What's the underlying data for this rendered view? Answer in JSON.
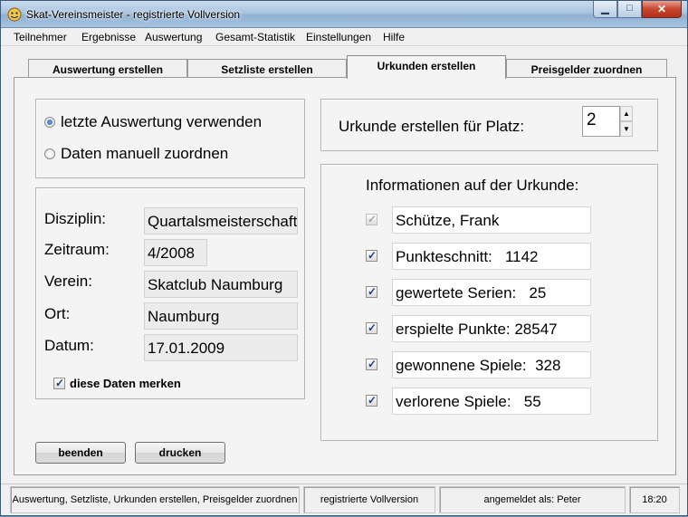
{
  "window": {
    "title": "Skat-Vereinsmeister - registrierte Vollversion"
  },
  "menu": [
    "Teilnehmer",
    "Ergebnisse",
    "Auswertung",
    "Gesamt-Statistik",
    "Einstellungen",
    "Hilfe"
  ],
  "tabs": [
    "Auswertung erstellen",
    "Setzliste erstellen",
    "Urkunden erstellen",
    "Preisgelder zuordnen"
  ],
  "source": {
    "option_last": "letzte Auswertung verwenden",
    "option_manual": "Daten manuell zuordnen",
    "selected": "option_last"
  },
  "details": {
    "disziplin_label": "Disziplin:",
    "disziplin_value": "Quartalsmeisterschaft",
    "zeitraum_label": "Zeitraum:",
    "zeitraum_value": "4/2008",
    "verein_label": "Verein:",
    "verein_value": "Skatclub Naumburg",
    "ort_label": "Ort:",
    "ort_value": "Naumburg",
    "datum_label": "Datum:",
    "datum_value": "17.01.2009",
    "remember_label": "diese Daten merken",
    "remember_checked": true
  },
  "certificate": {
    "place_label": "Urkunde erstellen für Platz:",
    "place_value": "2",
    "info_heading": "Informationen auf der Urkunde:",
    "rows": [
      {
        "text": "Schütze, Frank",
        "checked": true,
        "disabled": true
      },
      {
        "text": "Punkteschnitt:   1142",
        "checked": true,
        "disabled": false
      },
      {
        "text": "gewertete Serien:   25",
        "checked": true,
        "disabled": false
      },
      {
        "text": "erspielte Punkte: 28547",
        "checked": true,
        "disabled": false
      },
      {
        "text": "gewonnene Spiele:  328",
        "checked": true,
        "disabled": false
      },
      {
        "text": "verlorene Spiele:   55",
        "checked": true,
        "disabled": false
      }
    ]
  },
  "buttons": {
    "quit": "beenden",
    "print": "drucken"
  },
  "status": {
    "modules": "Auswertung, Setzliste, Urkunden erstellen, Preisgelder zuordnen",
    "license": "registrierte Vollversion",
    "user": "angemeldet als: Peter",
    "time": "18:20"
  }
}
